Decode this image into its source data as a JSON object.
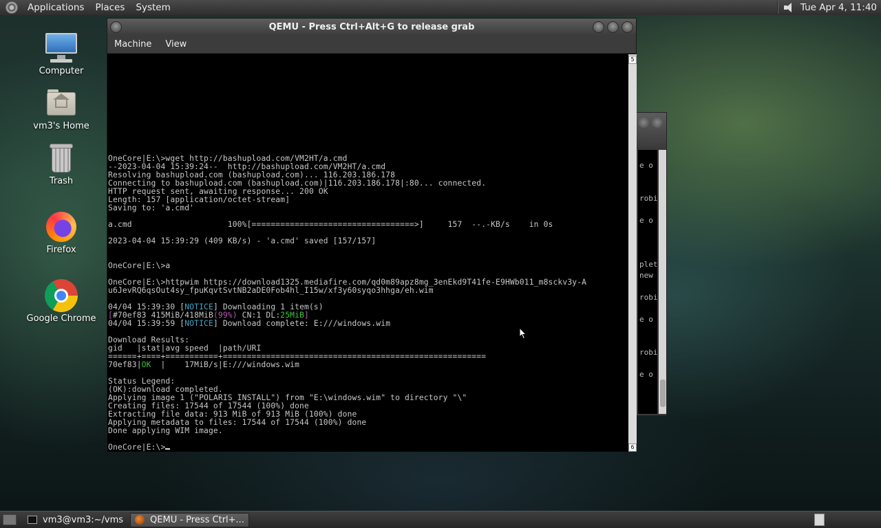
{
  "top_panel": {
    "menus": [
      "Applications",
      "Places",
      "System"
    ],
    "clock": "Tue Apr  4, 11:40"
  },
  "desktop_icons": [
    {
      "label": "Computer",
      "icon": "computer-icon"
    },
    {
      "label": "vm3's Home",
      "icon": "home-folder-icon"
    },
    {
      "label": "Trash",
      "icon": "trash-icon"
    },
    {
      "label": "Firefox",
      "icon": "firefox-icon"
    },
    {
      "label": "Google Chrome",
      "icon": "chrome-icon"
    }
  ],
  "qemu": {
    "title": "QEMU - Press Ctrl+Alt+G to release grab",
    "menus": [
      "Machine",
      "View"
    ],
    "scroll_top_num": "5",
    "scroll_bottom_num": "6",
    "lines": [
      {
        "parts": [
          {
            "t": "OneCore|E:\\>wget http://bashupload.com/VM2HT/a.cmd"
          }
        ]
      },
      {
        "parts": [
          {
            "t": "--2023-04-04 15:39:24--  http://bashupload.com/VM2HT/a.cmd"
          }
        ]
      },
      {
        "parts": [
          {
            "t": "Resolving bashupload.com (bashupload.com)... 116.203.186.178"
          }
        ]
      },
      {
        "parts": [
          {
            "t": "Connecting to bashupload.com (bashupload.com)|116.203.186.178|:80... connected."
          }
        ]
      },
      {
        "parts": [
          {
            "t": "HTTP request sent, awaiting response... 200 OK"
          }
        ]
      },
      {
        "parts": [
          {
            "t": "Length: 157 [application/octet-stream]"
          }
        ]
      },
      {
        "parts": [
          {
            "t": "Saving to: 'a.cmd'"
          }
        ]
      },
      {
        "parts": [
          {
            "t": ""
          }
        ]
      },
      {
        "parts": [
          {
            "t": "a.cmd                    100%[==================================>]     157  --.-KB/s    in 0s"
          }
        ]
      },
      {
        "parts": [
          {
            "t": ""
          }
        ]
      },
      {
        "parts": [
          {
            "t": "2023-04-04 15:39:29 (409 KB/s) - 'a.cmd' saved [157/157]"
          }
        ]
      },
      {
        "parts": [
          {
            "t": ""
          }
        ]
      },
      {
        "parts": [
          {
            "t": ""
          }
        ]
      },
      {
        "parts": [
          {
            "t": "OneCore|E:\\>a"
          }
        ]
      },
      {
        "parts": [
          {
            "t": ""
          }
        ]
      },
      {
        "parts": [
          {
            "t": "OneCore|E:\\>httpwim https://download1325.mediafire.com/qd0m89apz8mg_3enEkd9T41fe-E9HWb011_m8sckv3y-A"
          }
        ]
      },
      {
        "parts": [
          {
            "t": "u6JevRQ6qsOut4sy_fpuKqvtSvtNB2aDE0Fob4hl_I15w/xf3y60syqo3hhga/eh.wim"
          }
        ]
      },
      {
        "parts": [
          {
            "t": ""
          }
        ]
      },
      {
        "parts": [
          {
            "t": "04/04 15:39:30 ["
          },
          {
            "t": "NOTICE",
            "c": "notice"
          },
          {
            "t": "] Downloading 1 item(s)"
          }
        ]
      },
      {
        "parts": [
          {
            "t": "[",
            "c": "mag"
          },
          {
            "t": "#70ef83 415MiB/418MiB",
            "c": "bg"
          },
          {
            "t": "(99%)",
            "c": "mag"
          },
          {
            "t": " CN:1 DL:",
            "c": "bg"
          },
          {
            "t": "25MiB",
            "c": "ok"
          },
          {
            "t": "]",
            "c": "mag"
          }
        ]
      },
      {
        "parts": [
          {
            "t": "04/04 15:39:59 ["
          },
          {
            "t": "NOTICE",
            "c": "notice"
          },
          {
            "t": "] Download complete: E:///windows.wim"
          }
        ]
      },
      {
        "parts": [
          {
            "t": ""
          }
        ]
      },
      {
        "parts": [
          {
            "t": "Download Results:"
          }
        ]
      },
      {
        "parts": [
          {
            "t": "gid   |stat|avg speed  |path/URI"
          }
        ]
      },
      {
        "parts": [
          {
            "t": "======+====+===========+======================================================="
          }
        ]
      },
      {
        "parts": [
          {
            "t": "70ef83|"
          },
          {
            "t": "OK",
            "c": "ok"
          },
          {
            "t": "  |    17MiB/s|E:///windows.wim"
          }
        ]
      },
      {
        "parts": [
          {
            "t": ""
          }
        ]
      },
      {
        "parts": [
          {
            "t": "Status Legend:"
          }
        ]
      },
      {
        "parts": [
          {
            "t": "(OK):download completed."
          }
        ]
      },
      {
        "parts": [
          {
            "t": "Applying image 1 (\"POLARIS_INSTALL\") from \"E:\\windows.wim\" to directory \"\\\""
          }
        ]
      },
      {
        "parts": [
          {
            "t": "Creating files: 17544 of 17544 (100%) done"
          }
        ]
      },
      {
        "parts": [
          {
            "t": "Extracting file data: 913 MiB of 913 MiB (100%) done"
          }
        ]
      },
      {
        "parts": [
          {
            "t": "Applying metadata to files: 17544 of 17544 (100%) done"
          }
        ]
      },
      {
        "parts": [
          {
            "t": "Done applying WIM image."
          }
        ]
      },
      {
        "parts": [
          {
            "t": ""
          }
        ]
      },
      {
        "parts": [
          {
            "t": "OneCore|E:\\>"
          }
        ],
        "cursor": true
      }
    ]
  },
  "background_terminal": {
    "fragments": [
      "e o",
      "robi",
      "e o",
      "plet",
      "new",
      "robi",
      "e o",
      "robi",
      "e o"
    ]
  },
  "taskbar": {
    "tasks": [
      {
        "label": "vm3@vm3:~/vms",
        "icon": "terminal-icon",
        "active": false
      },
      {
        "label": "QEMU - Press Ctrl+...",
        "icon": "qemu-icon",
        "active": true
      }
    ]
  }
}
